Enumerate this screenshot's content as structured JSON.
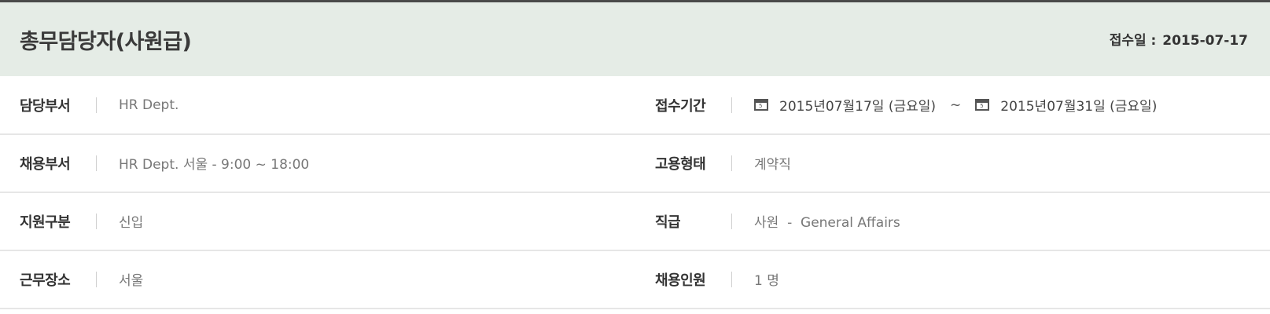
{
  "header": {
    "title": "총무담당자(사원급)",
    "received_label": "접수일 :",
    "received_date": "2015-07-17"
  },
  "rows": [
    {
      "left": {
        "label": "담당부서",
        "value": "HR Dept."
      },
      "right": {
        "label": "접수기간",
        "start": "2015년07월17일 (금요일)",
        "separator": "~",
        "end": "2015년07월31일 (금요일)"
      }
    },
    {
      "left": {
        "label": "채용부서",
        "value": "HR Dept. 서울 - 9:00 ~ 18:00"
      },
      "right": {
        "label": "고용형태",
        "value": "계약직"
      }
    },
    {
      "left": {
        "label": "지원구분",
        "value": "신입"
      },
      "right": {
        "label": "직급",
        "value": "사원  -  General Affairs"
      }
    },
    {
      "left": {
        "label": "근무장소",
        "value": "서울"
      },
      "right": {
        "label": "채용인원",
        "value": "1 명"
      }
    }
  ],
  "icons": {
    "calendar": "calendar-icon",
    "calendar_glyph": "5"
  },
  "colors": {
    "header_bg": "#e5ece6",
    "top_border": "#4a4a4a",
    "row_divider": "#e6e6e6"
  }
}
